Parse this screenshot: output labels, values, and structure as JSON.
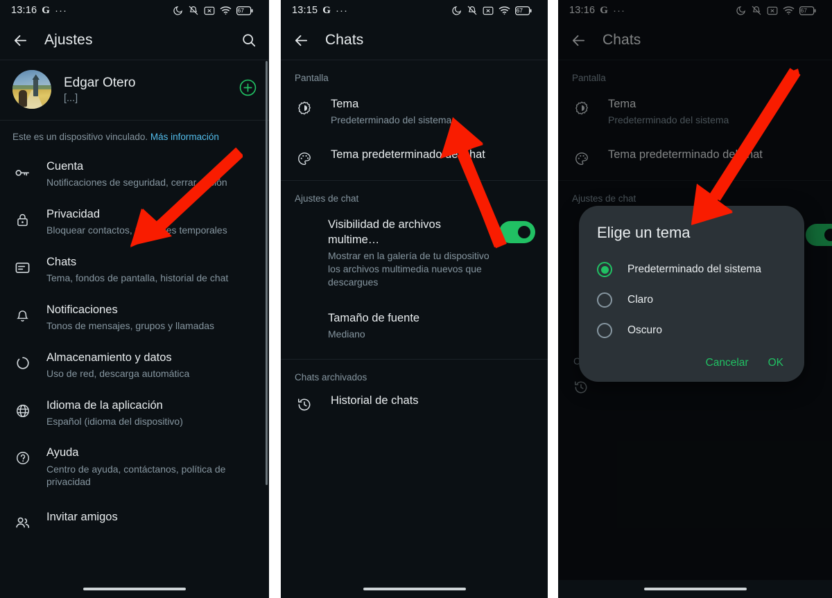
{
  "panels": [
    {
      "id": "settings",
      "status_bar": {
        "time": "13:16",
        "brand": "G",
        "overflow": "···",
        "icons": [
          "moon-icon",
          "bell-muted-icon",
          "x-box-icon",
          "wifi-icon",
          "battery-icon"
        ],
        "battery_level": "67"
      },
      "app_bar": {
        "back": "back-arrow-icon",
        "title": "Ajustes",
        "action": "search-icon"
      },
      "profile": {
        "name": "Edgar Otero",
        "status": "[...]",
        "add_label": "+"
      },
      "linked_note": {
        "text": "Este es un dispositivo vinculado. ",
        "link": "Más información"
      },
      "items": [
        {
          "icon": "key-icon",
          "title": "Cuenta",
          "subtitle": "Notificaciones de seguridad, cerrar sesión"
        },
        {
          "icon": "lock-icon",
          "title": "Privacidad",
          "subtitle": "Bloquear contactos, mensajes temporales"
        },
        {
          "icon": "chat-icon",
          "title": "Chats",
          "subtitle": "Tema, fondos de pantalla, historial de chat"
        },
        {
          "icon": "bell-icon",
          "title": "Notificaciones",
          "subtitle": "Tonos de mensajes, grupos y llamadas"
        },
        {
          "icon": "refresh-icon",
          "title": "Almacenamiento y datos",
          "subtitle": "Uso de red, descarga automática"
        },
        {
          "icon": "globe-icon",
          "title": "Idioma de la aplicación",
          "subtitle": "Español (idioma del dispositivo)"
        },
        {
          "icon": "help-icon",
          "title": "Ayuda",
          "subtitle": "Centro de ayuda, contáctanos, política de privacidad"
        },
        {
          "icon": "people-icon",
          "title": "Invitar amigos",
          "subtitle": ""
        }
      ]
    },
    {
      "id": "chats",
      "status_bar": {
        "time": "13:15",
        "brand": "G",
        "overflow": "···",
        "battery_level": "67"
      },
      "app_bar": {
        "back": "back-arrow-icon",
        "title": "Chats"
      },
      "sections": [
        {
          "header": "Pantalla",
          "rows": [
            {
              "icon": "contrast-icon",
              "title": "Tema",
              "subtitle": "Predeterminado del sistema",
              "toggle": null
            },
            {
              "icon": "palette-icon",
              "title": "Tema predeterminado del chat",
              "subtitle": "",
              "toggle": null
            }
          ]
        },
        {
          "header": "Ajustes de chat",
          "rows": [
            {
              "icon": "",
              "title": "Visibilidad de archivos multime…",
              "subtitle": "Mostrar en la galería de tu dispositivo los archivos multimedia nuevos que descargues",
              "toggle": "on"
            },
            {
              "icon": "",
              "title": "Tamaño de fuente",
              "subtitle": "Mediano",
              "toggle": null
            }
          ]
        },
        {
          "header": "Chats archivados",
          "rows": [
            {
              "icon": "history-icon",
              "title": "Historial de chats",
              "subtitle": "",
              "toggle": null
            }
          ]
        }
      ]
    },
    {
      "id": "chats-dialog",
      "status_bar": {
        "time": "13:16",
        "brand": "G",
        "overflow": "···",
        "battery_level": "67"
      },
      "app_bar": {
        "back": "back-arrow-icon",
        "title": "Chats"
      },
      "sections": [
        {
          "header": "Pantalla",
          "rows": [
            {
              "icon": "contrast-icon",
              "title": "Tema",
              "subtitle": "Predeterminado del sistema"
            },
            {
              "icon": "palette-icon",
              "title": "Tema predeterminado del chat",
              "subtitle": ""
            }
          ]
        },
        {
          "header": "Ajustes de chat",
          "rows": []
        }
      ],
      "dialog": {
        "title": "Elige un tema",
        "options": [
          {
            "label": "Predeterminado del sistema",
            "selected": true
          },
          {
            "label": "Claro",
            "selected": false
          },
          {
            "label": "Oscuro",
            "selected": false
          }
        ],
        "cancel": "Cancelar",
        "ok": "OK"
      }
    }
  ],
  "colors": {
    "background": "#0b1014",
    "accent_green": "#21c063",
    "link_blue": "#53bdeb",
    "text_primary": "#e9edef",
    "text_secondary": "#8696a0",
    "dialog_bg": "#2b3237",
    "annotation_red": "#f91c00"
  }
}
